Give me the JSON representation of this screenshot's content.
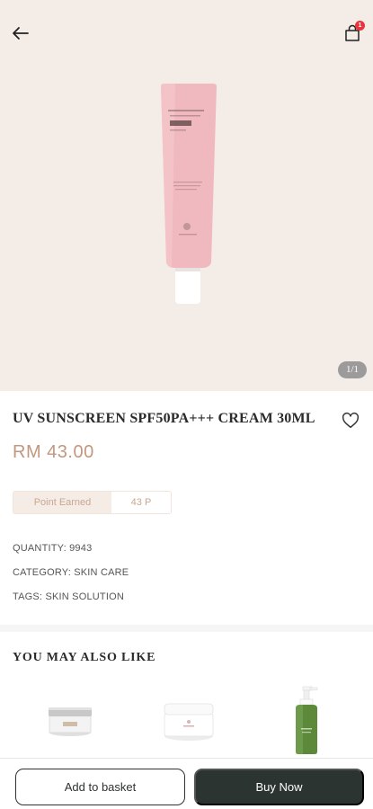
{
  "header": {
    "back_icon": "arrow-left-icon",
    "cart_icon": "shopping-bag-icon",
    "cart_badge": "1"
  },
  "gallery": {
    "counter": "1/1",
    "product_image": "pink-sunscreen-tube"
  },
  "product": {
    "title": "UV SUNSCREEN SPF50PA+++ CREAM 30ML",
    "price": "RM 43.00",
    "points_label": "Point Earned",
    "points_value": "43 P",
    "quantity": "QUANTITY: 9943",
    "category": "CATEGORY: SKIN CARE",
    "tags": "TAGS: SKIN SOLUTION",
    "wishlist_icon": "heart-outline-icon"
  },
  "recommendations": {
    "title": "YOU MAY ALSO LIKE",
    "items": [
      "cream-jar-silver",
      "cream-jar-white",
      "green-pump-bottle"
    ]
  },
  "actions": {
    "add_to_basket": "Add to basket",
    "buy_now": "Buy Now"
  },
  "colors": {
    "hero_bg": "#f4ece6",
    "price": "#c2977f",
    "primary_button": "#2c3431",
    "badge": "#e8343a"
  }
}
